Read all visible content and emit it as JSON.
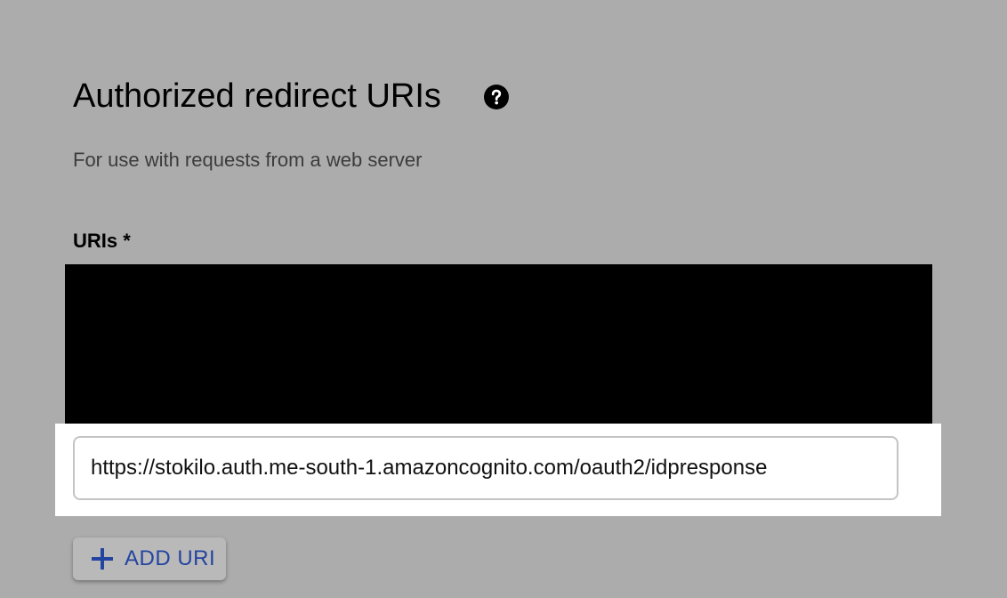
{
  "section": {
    "title": "Authorized redirect URIs",
    "help_icon": "help-circle-icon",
    "subtitle": "For use with requests from a web server"
  },
  "uris": {
    "label": "URIs *",
    "redacted": true,
    "entries": [
      {
        "value": "https://stokilo.auth.me-south-1.amazoncognito.com/oauth2/idpresponse"
      }
    ]
  },
  "add_button": {
    "icon": "plus-icon",
    "label": "ADD URI"
  },
  "colors": {
    "background": "#acacac",
    "accent": "#2344a0",
    "highlight": "#ffffff",
    "redaction": "#000000"
  }
}
